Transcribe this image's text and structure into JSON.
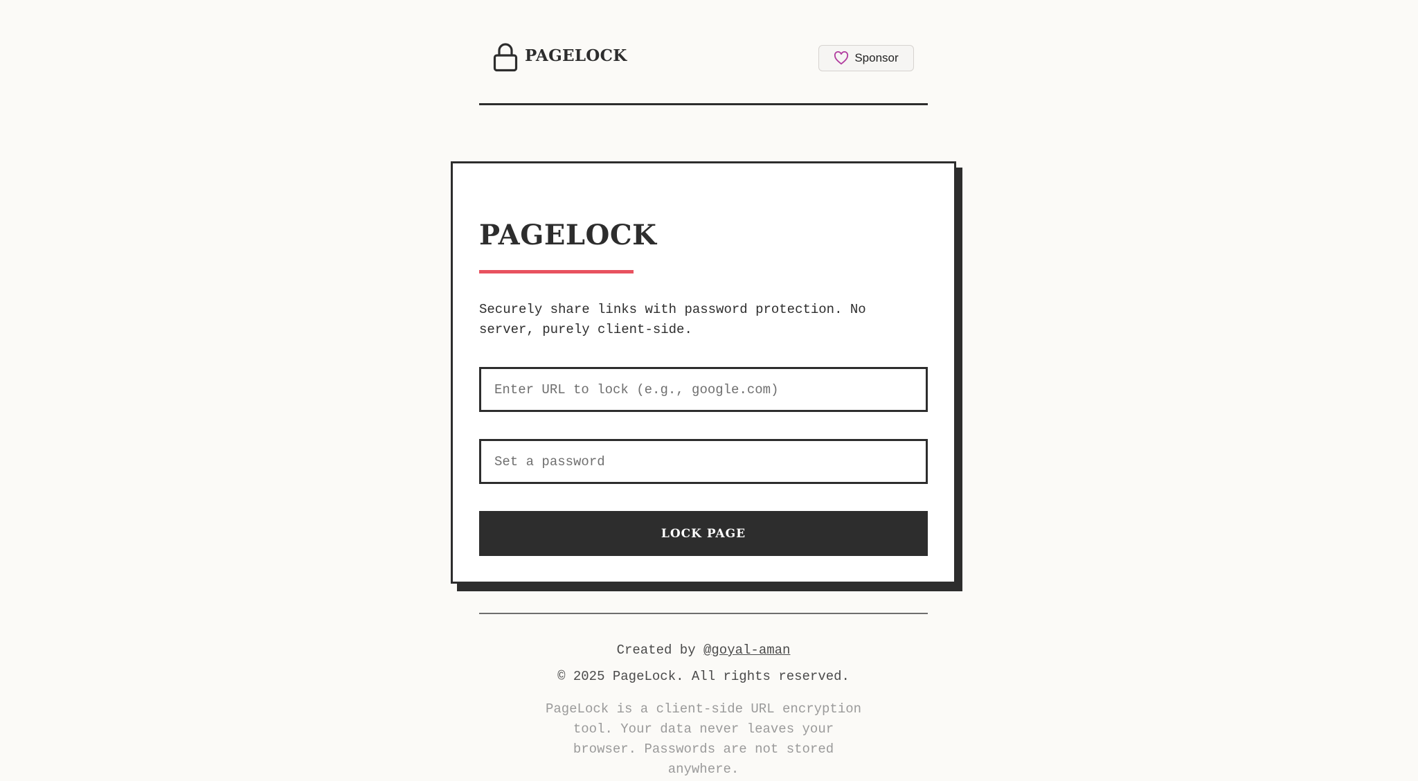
{
  "header": {
    "brand_name": "PAGELOCK",
    "brand_icon": "lock-icon",
    "sponsor_label": "Sponsor",
    "sponsor_icon": "heart-icon",
    "sponsor_icon_color": "#b13c9e"
  },
  "card": {
    "title": "PAGELOCK",
    "accent_color": "#e8525f",
    "description": "Securely share links with password protection. No server, purely client-side.",
    "url_placeholder": "Enter URL to lock (e.g., google.com)",
    "url_value": "",
    "password_placeholder": "Set a password",
    "password_value": "",
    "button_label": "LOCK PAGE"
  },
  "footer": {
    "created_prefix": "Created by ",
    "author": "@goyal-aman",
    "copyright": "© 2025 PageLock. All rights reserved.",
    "disclaimer": "PageLock is a client-side URL encryption tool. Your data never leaves your browser. Passwords are not stored anywhere."
  }
}
